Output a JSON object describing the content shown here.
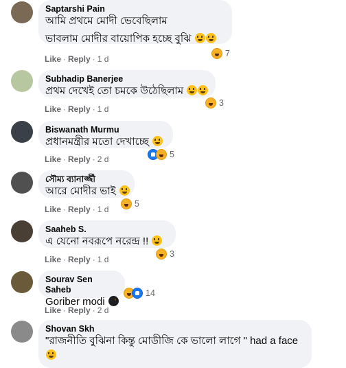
{
  "comments": [
    {
      "author": "Saptarshi Pain",
      "lines": [
        "আমি প্রথমে মোদী ভেবেছিলাম",
        "ভাবলাম মোদীর বায়োপিক হচ্ছে বুঝি"
      ],
      "like": "Like",
      "reply": "Reply",
      "time": "1 d",
      "reaction_count": "7",
      "emojis": [
        "grinning",
        "grinning"
      ],
      "reaction_icons": [
        "haha-icon"
      ]
    },
    {
      "author": "Subhadip Banerjee",
      "lines": [
        "প্রথম দেখেই তো চমকে উঠেছিলাম"
      ],
      "like": "Like",
      "reply": "Reply",
      "time": "1 d",
      "reaction_count": "3",
      "emojis": [
        "grinning",
        "astonished"
      ],
      "reaction_icons": [
        "haha-icon"
      ]
    },
    {
      "author": "Biswanath Murmu",
      "lines": [
        "প্রধানমন্ত্রীর মতো দেখাচ্ছে"
      ],
      "like": "Like",
      "reply": "Reply",
      "time": "2 d",
      "reaction_count": "5",
      "emojis": [
        "grimacing"
      ],
      "reaction_icons": [
        "like-icon",
        "haha-icon"
      ]
    },
    {
      "author": "সৌম্য ব্যানার্জ্জী",
      "lines": [
        "আরে মোদীর ভাই"
      ],
      "like": "Like",
      "reply": "Reply",
      "time": "1 d",
      "reaction_count": "5",
      "emojis": [
        "laughing"
      ],
      "reaction_icons": [
        "haha-icon"
      ]
    },
    {
      "author": "Saaheb S.",
      "lines": [
        "এ যেনো নবরূপে নরেন্দ্র !!"
      ],
      "like": "Like",
      "reply": "Reply",
      "time": "1 d",
      "reaction_count": "3",
      "emojis": [
        "laughing"
      ],
      "reaction_icons": [
        "haha-icon"
      ]
    },
    {
      "author": "Sourav Sen Saheb",
      "lines": [
        "Goriber modi"
      ],
      "like": "Like",
      "reply": "Reply",
      "time": "2 d",
      "reaction_count": "14",
      "emojis": [
        "black-circle"
      ],
      "reaction_icons": [
        "haha-icon",
        "like-icon"
      ]
    },
    {
      "author": "Shovan Skh",
      "lines": [
        "\"রাজনীতি বুঝিনা কিন্তু মোডীজি কে ভালো লাগে \" had a face"
      ],
      "like": "",
      "reply": "",
      "time": "",
      "reaction_count": "",
      "emojis": [
        "smiling"
      ],
      "reaction_icons": []
    }
  ],
  "colors": {
    "bubble": "#f0f2f5",
    "meta": "#65676b",
    "haha": "#f7b125",
    "like": "#1877f2"
  }
}
